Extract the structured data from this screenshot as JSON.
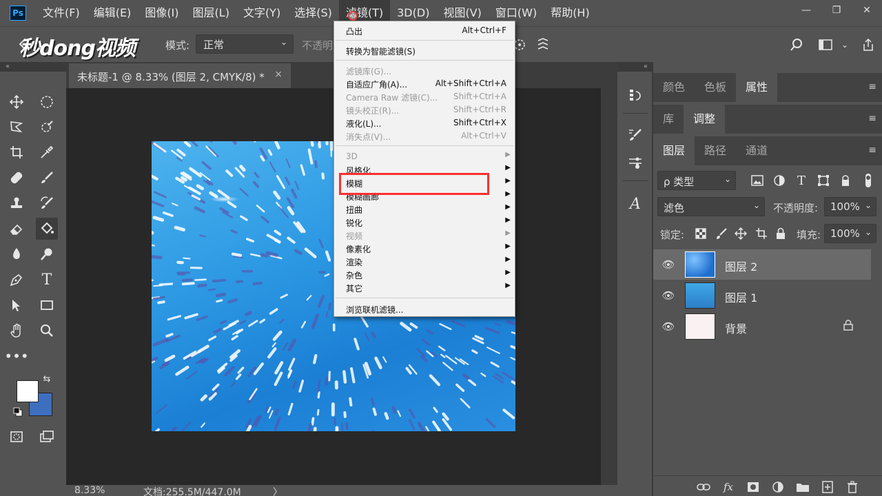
{
  "app": {
    "logo": "Ps"
  },
  "menubar": {
    "items": [
      "文件(F)",
      "编辑(E)",
      "图像(I)",
      "图层(L)",
      "文字(Y)",
      "选择(S)",
      "滤镜(T)",
      "3D(D)",
      "视图(V)",
      "窗口(W)",
      "帮助(H)"
    ],
    "active": "滤镜(T)"
  },
  "window_controls": {
    "minimize": "—",
    "restore": "❐",
    "close": "✕"
  },
  "options_bar": {
    "watermark": "秒dong视频",
    "mode_label": "模式:",
    "mode_value": "正常",
    "opacity_label": "不透明"
  },
  "document": {
    "tab_title": "未标题-1 @ 8.33% (图层 2, CMYK/8) *",
    "close": "×"
  },
  "status": {
    "zoom": "8.33%",
    "doc_info": "文档:255.5M/447.0M",
    "arrow": "〉"
  },
  "filter_menu": {
    "items": [
      {
        "label": "凸出",
        "shortcut": "Alt+Ctrl+F",
        "disabled": false
      },
      {
        "label": "转换为智能滤镜(S)",
        "shortcut": "",
        "disabled": false
      },
      {
        "label": "滤镜库(G)...",
        "shortcut": "",
        "disabled": true
      },
      {
        "label": "自适应广角(A)...",
        "shortcut": "Alt+Shift+Ctrl+A",
        "disabled": false
      },
      {
        "label": "Camera Raw 滤镜(C)...",
        "shortcut": "Shift+Ctrl+A",
        "disabled": true
      },
      {
        "label": "镜头校正(R)...",
        "shortcut": "Shift+Ctrl+R",
        "disabled": true
      },
      {
        "label": "液化(L)...",
        "shortcut": "Shift+Ctrl+X",
        "disabled": false
      },
      {
        "label": "消失点(V)...",
        "shortcut": "Alt+Ctrl+V",
        "disabled": true
      },
      {
        "label": "3D",
        "shortcut": "",
        "disabled": true
      },
      {
        "label": "风格化",
        "shortcut": "",
        "disabled": false
      },
      {
        "label": "模糊",
        "shortcut": "",
        "disabled": false
      },
      {
        "label": "模糊画廊",
        "shortcut": "",
        "disabled": false
      },
      {
        "label": "扭曲",
        "shortcut": "",
        "disabled": false
      },
      {
        "label": "锐化",
        "shortcut": "",
        "disabled": false
      },
      {
        "label": "视频",
        "shortcut": "",
        "disabled": true
      },
      {
        "label": "像素化",
        "shortcut": "",
        "disabled": false
      },
      {
        "label": "渲染",
        "shortcut": "",
        "disabled": false
      },
      {
        "label": "杂色",
        "shortcut": "",
        "disabled": false
      },
      {
        "label": "其它",
        "shortcut": "",
        "disabled": false
      },
      {
        "label": "浏览联机滤镜...",
        "shortcut": "",
        "disabled": false
      }
    ],
    "highlighted": "模糊"
  },
  "panels": {
    "top_tabs": [
      "颜色",
      "色板",
      "属性"
    ],
    "top_active": "属性",
    "mid_tabs": [
      "库",
      "调整"
    ],
    "mid_active": "调整",
    "layer_tabs": [
      "图层",
      "路径",
      "通道"
    ],
    "layer_active": "图层",
    "filter_kind": "ρ 类型",
    "blend_mode": "滤色",
    "opacity_label": "不透明度:",
    "opacity_value": "100%",
    "lock_label": "锁定:",
    "fill_label": "填充:",
    "fill_value": "100%",
    "layers": [
      {
        "name": "图层 2",
        "selected": true,
        "thumb": "#1f6fcf",
        "locked": false
      },
      {
        "name": "图层 1",
        "selected": false,
        "thumb": "#2d8fd8",
        "locked": false
      },
      {
        "name": "背景",
        "selected": false,
        "thumb": "#faf2f2",
        "locked": true
      }
    ]
  }
}
